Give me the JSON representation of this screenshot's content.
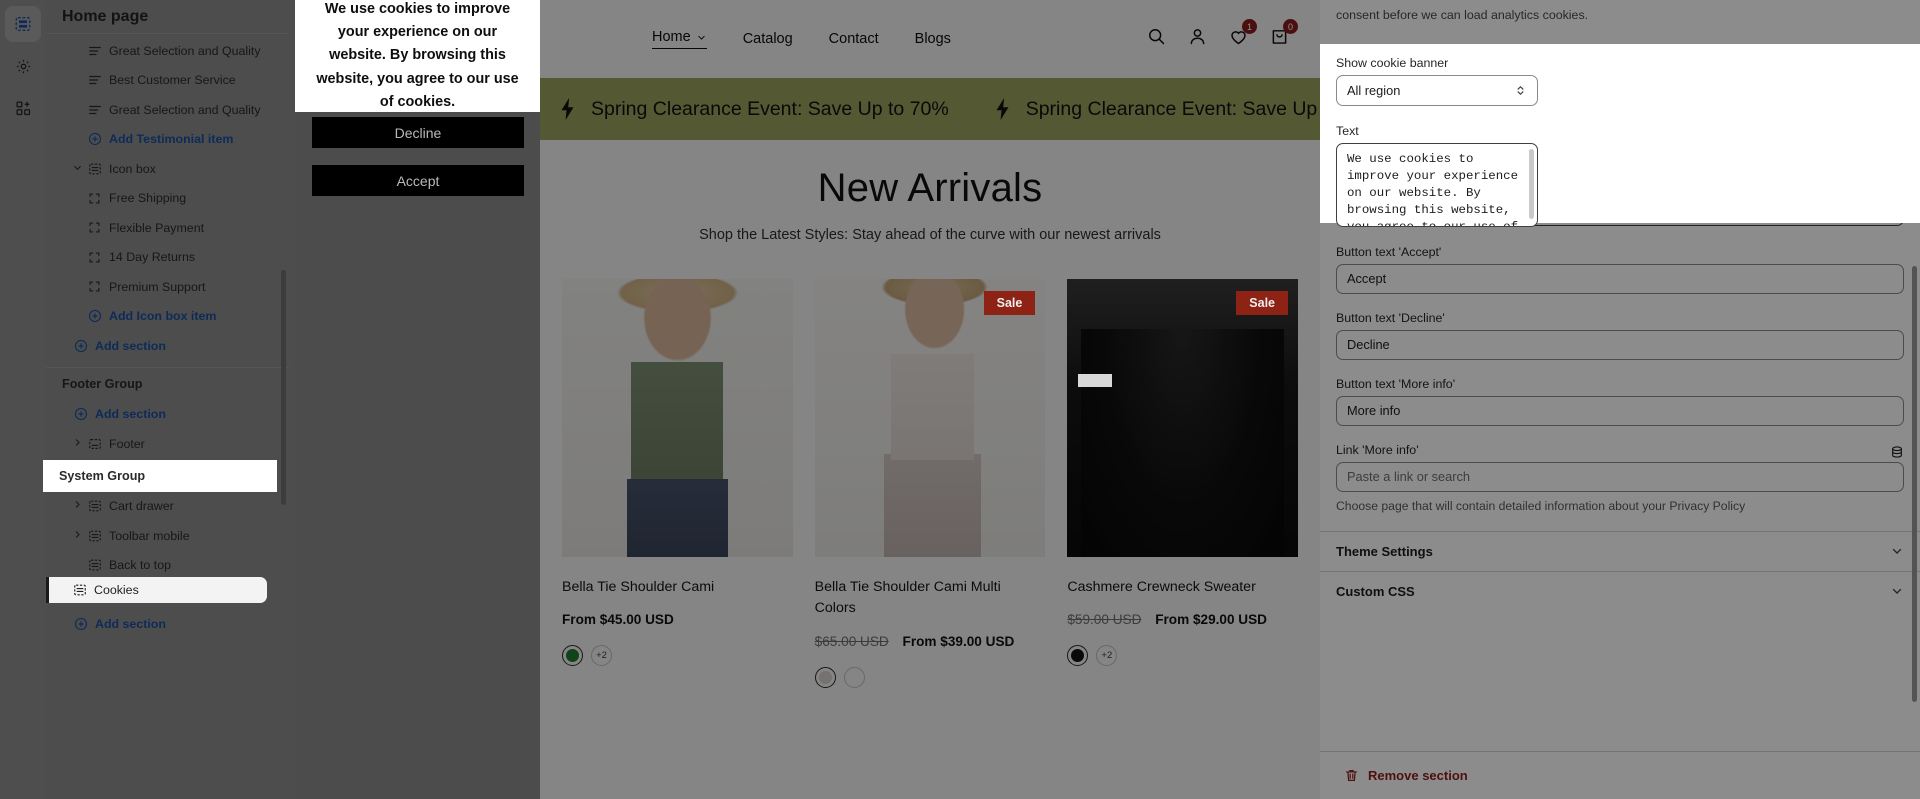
{
  "rail": {
    "items": [
      {
        "name": "sections-icon",
        "label": "Sections"
      },
      {
        "name": "settings-gear-icon",
        "label": "Settings"
      },
      {
        "name": "apps-add-icon",
        "label": "Apps"
      }
    ]
  },
  "sidebar": {
    "title": "Home page",
    "rows": [
      {
        "label": "Great Selection and Quality",
        "icon": "text-lines-icon",
        "type": "block"
      },
      {
        "label": "Best Customer Service",
        "icon": "text-lines-icon",
        "type": "block"
      },
      {
        "label": "Great Selection and Quality",
        "icon": "text-lines-icon",
        "type": "block"
      },
      {
        "label": "Add Testimonial item",
        "icon": "plus-circle-icon",
        "type": "add"
      },
      {
        "label": "Icon box",
        "icon": "section-icon",
        "type": "section",
        "caret": "chevron-down-icon"
      },
      {
        "label": "Free Shipping",
        "icon": "brackets-icon",
        "type": "subblock"
      },
      {
        "label": "Flexible Payment",
        "icon": "brackets-icon",
        "type": "subblock"
      },
      {
        "label": "14 Day Returns",
        "icon": "brackets-icon",
        "type": "subblock"
      },
      {
        "label": "Premium Support",
        "icon": "brackets-icon",
        "type": "subblock"
      },
      {
        "label": "Add Icon box item",
        "icon": "plus-circle-icon",
        "type": "add"
      },
      {
        "label": "Add section",
        "icon": "plus-circle-icon",
        "type": "add-section"
      }
    ],
    "footer_group": {
      "title": "Footer Group",
      "add_section": "Add section",
      "footer_item": "Footer"
    },
    "system_group": {
      "title": "System Group",
      "items": [
        {
          "label": "Cart drawer",
          "caret": "chevron-right-icon"
        },
        {
          "label": "Toolbar mobile",
          "caret": "chevron-right-icon"
        },
        {
          "label": "Back to top",
          "caret": ""
        },
        {
          "label": "Cookies",
          "caret": "",
          "selected": true
        }
      ],
      "add_section": "Add section"
    }
  },
  "preview": {
    "nav": {
      "links": [
        {
          "label": "Home",
          "active": true,
          "caret": "chevron-down-icon"
        },
        {
          "label": "Catalog",
          "active": false,
          "caret": ""
        },
        {
          "label": "Contact",
          "active": false,
          "caret": ""
        },
        {
          "label": "Blogs",
          "active": false,
          "caret": ""
        }
      ],
      "icons": [
        {
          "name": "search-icon",
          "badge": ""
        },
        {
          "name": "account-person-icon",
          "badge": ""
        },
        {
          "name": "wishlist-heart-icon",
          "badge": "1"
        },
        {
          "name": "cart-bag-icon",
          "badge": "0"
        }
      ]
    },
    "marquee": {
      "text": "Spring Clearance Event: Save Up to 70%",
      "text_truncated": "Spring Clearance Event: Save Up",
      "icon": "lightning-bolt-icon",
      "bg": "#9aa05d"
    },
    "section": {
      "title": "New Arrivals",
      "subtitle": "Shop the Latest Styles: Stay ahead of the curve with our newest arrivals"
    },
    "products": [
      {
        "title": "Bella Tie Shoulder Cami",
        "price": "From $45.00 USD",
        "compare_at": "",
        "sale_badge": "",
        "swatch_color": "#1f7a2f",
        "more_swatches": "+2"
      },
      {
        "title": "Bella Tie Shoulder Cami Multi Colors",
        "price": "From $39.00 USD",
        "compare_at": "$65.00 USD",
        "sale_badge": "Sale",
        "swatch_color": "#d7cfca",
        "more_swatches": ""
      },
      {
        "title": "Cashmere Crewneck Sweater",
        "price": "From $29.00 USD",
        "compare_at": "$59.00 USD",
        "sale_badge": "Sale",
        "swatch_color": "#111111",
        "more_swatches": "+2"
      }
    ],
    "cookie_banner": {
      "text": "We use cookies to improve your experience on our website. By browsing this website, you agree to our use of cookies.",
      "decline_label": "Decline",
      "accept_label": "Accept"
    }
  },
  "right_panel": {
    "top_note": "consent before we can load analytics cookies.",
    "show_banner": {
      "label": "Show cookie banner",
      "value": "All region"
    },
    "text": {
      "label": "Text",
      "value": "We use cookies to improve your experience on our website. By browsing this website, you agree to our use of cookies."
    },
    "accept": {
      "label": "Button text 'Accept'",
      "value": "Accept"
    },
    "decline": {
      "label": "Button text 'Decline'",
      "value": "Decline"
    },
    "more_info": {
      "label": "Button text 'More info'",
      "value": "More info"
    },
    "link_more_info": {
      "label": "Link 'More info'",
      "placeholder": "Paste a link or search",
      "help": "Choose page that will contain detailed information about your Privacy Policy",
      "icon": "database-icon"
    },
    "theme_settings": {
      "label": "Theme Settings",
      "caret": "chevron-down-icon"
    },
    "custom_css": {
      "label": "Custom CSS",
      "caret": "chevron-down-icon"
    },
    "remove_section": {
      "label": "Remove section",
      "icon": "trash-icon",
      "color": "#8f1d1d"
    }
  }
}
